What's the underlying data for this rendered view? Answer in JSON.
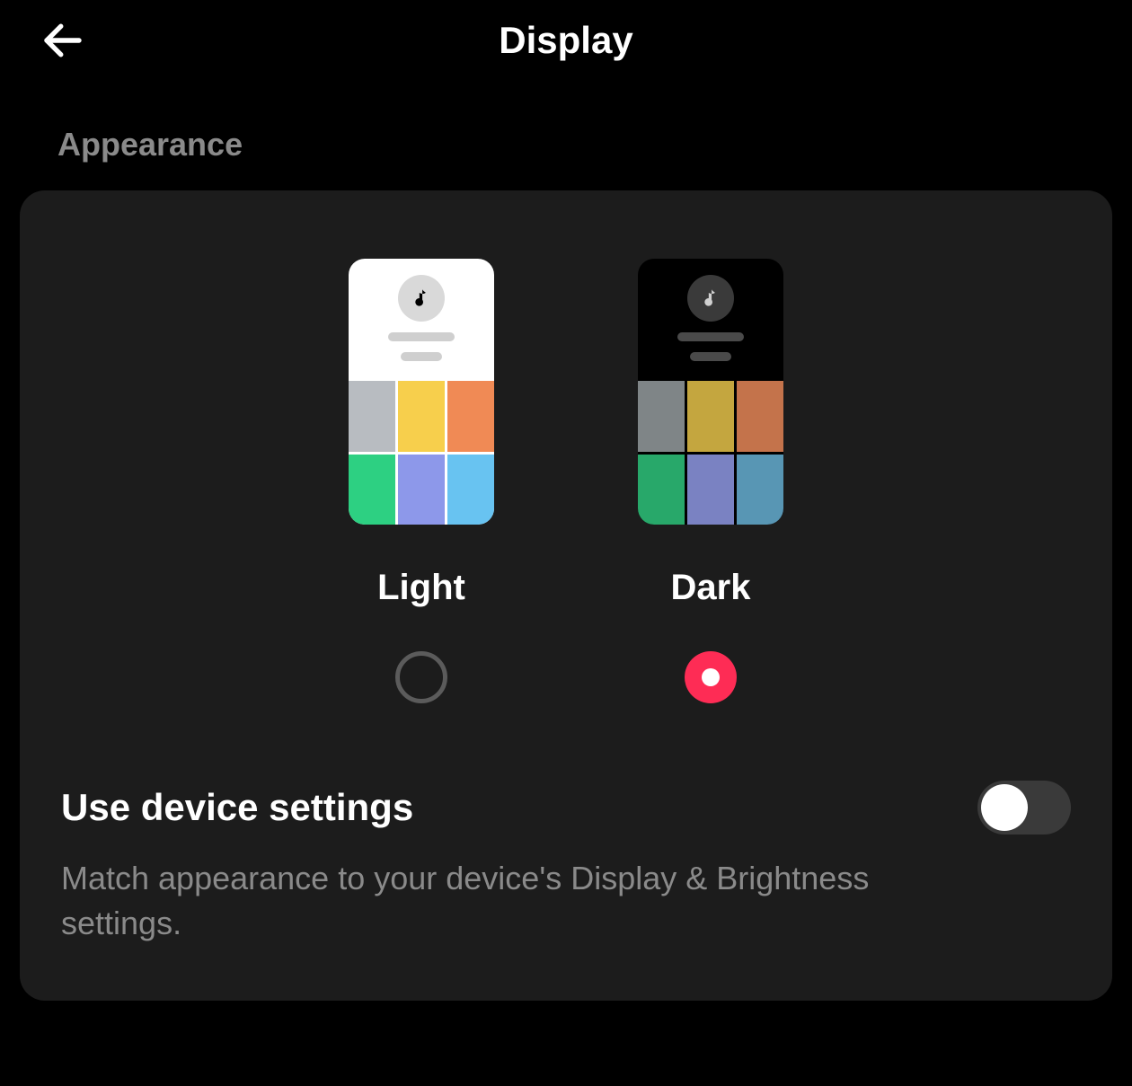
{
  "header": {
    "title": "Display"
  },
  "section": {
    "label": "Appearance"
  },
  "themes": {
    "options": [
      {
        "id": "light",
        "label": "Light",
        "selected": false
      },
      {
        "id": "dark",
        "label": "Dark",
        "selected": true
      }
    ],
    "preview_colors": {
      "light": [
        "#b8bcc1",
        "#f7cf4c",
        "#f08a55",
        "#2dd082",
        "#8d98ea",
        "#68c3f1"
      ],
      "dark": [
        "#7f8587",
        "#c4a63f",
        "#c4734b",
        "#28a86a",
        "#7a82c2",
        "#5896b4"
      ]
    }
  },
  "device_settings": {
    "title": "Use device settings",
    "description": "Match appearance to your device's Display & Brightness settings.",
    "enabled": false
  },
  "icons": {
    "back": "back-arrow-icon",
    "note": "music-note-icon"
  },
  "colors": {
    "accent": "#fe2c55",
    "panel_bg": "#1c1c1c",
    "muted_text": "#8a8a8a"
  }
}
